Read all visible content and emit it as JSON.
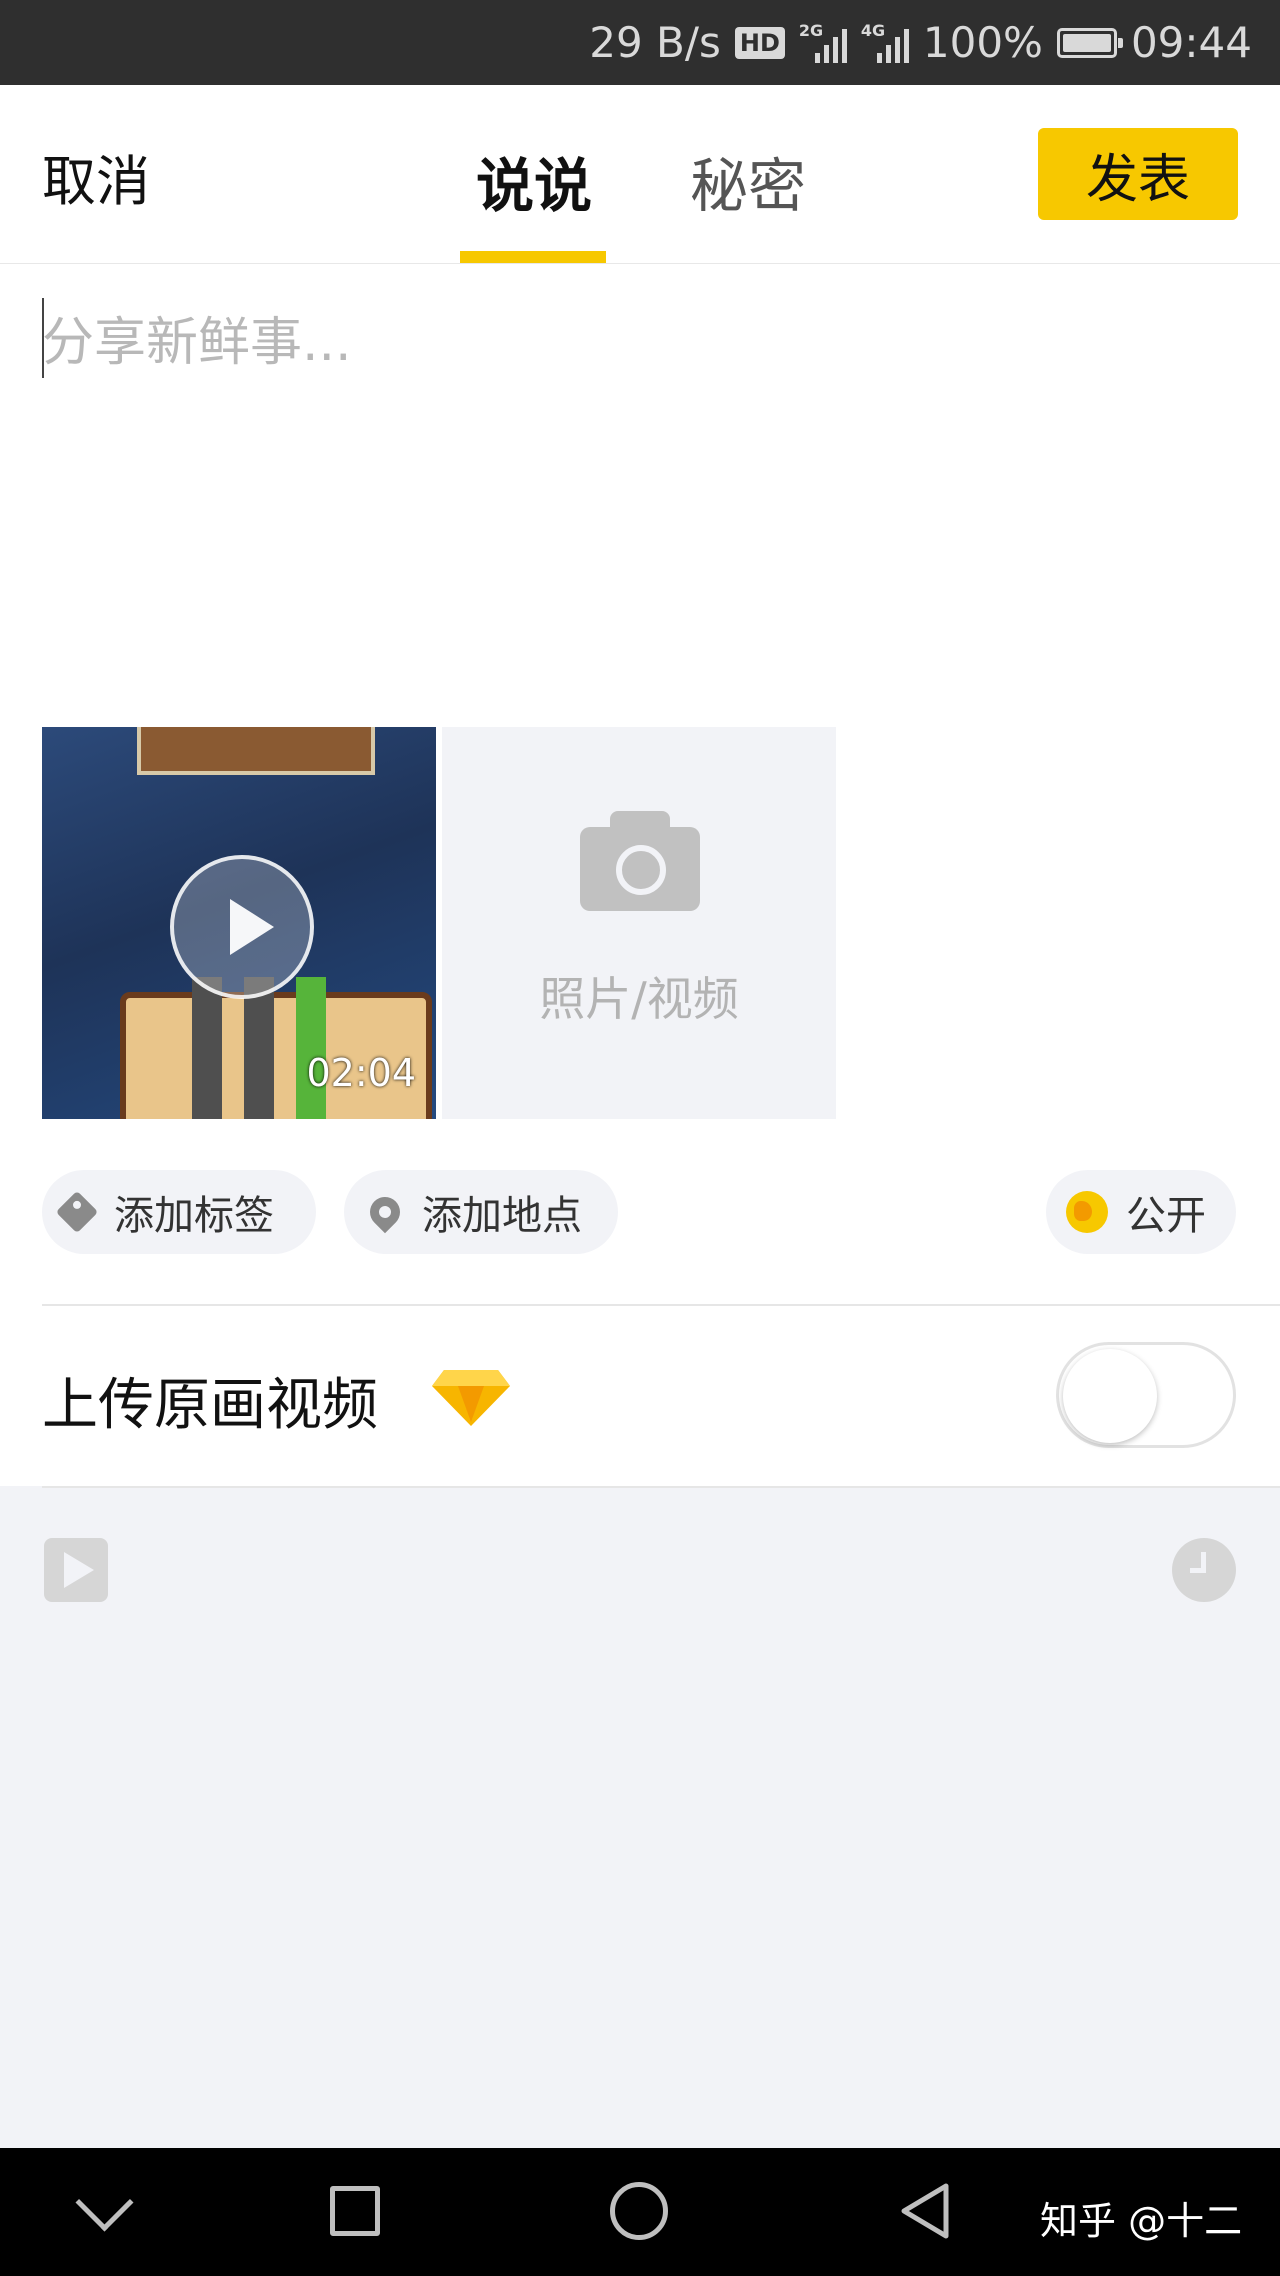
{
  "status_bar": {
    "net_speed": "29 B/s",
    "hd_badge": "HD",
    "sim1_type": "2G",
    "sim2_type": "4G",
    "battery": "100%",
    "battery_level": 1.0,
    "time": "09:44"
  },
  "header": {
    "cancel_label": "取消",
    "tabs": [
      {
        "label": "说说",
        "active": true
      },
      {
        "label": "秘密",
        "active": false
      }
    ],
    "publish_label": "发表",
    "accent_color": "#f7c800"
  },
  "compose": {
    "placeholder": "分享新鲜事..."
  },
  "media": {
    "video_duration": "02:04",
    "add_label": "照片/视频"
  },
  "chips": {
    "tag_label": "添加标签",
    "location_label": "添加地点",
    "visibility_label": "公开"
  },
  "upload": {
    "label": "上传原画视频",
    "enabled": false
  },
  "watermark": "知乎 @十二"
}
